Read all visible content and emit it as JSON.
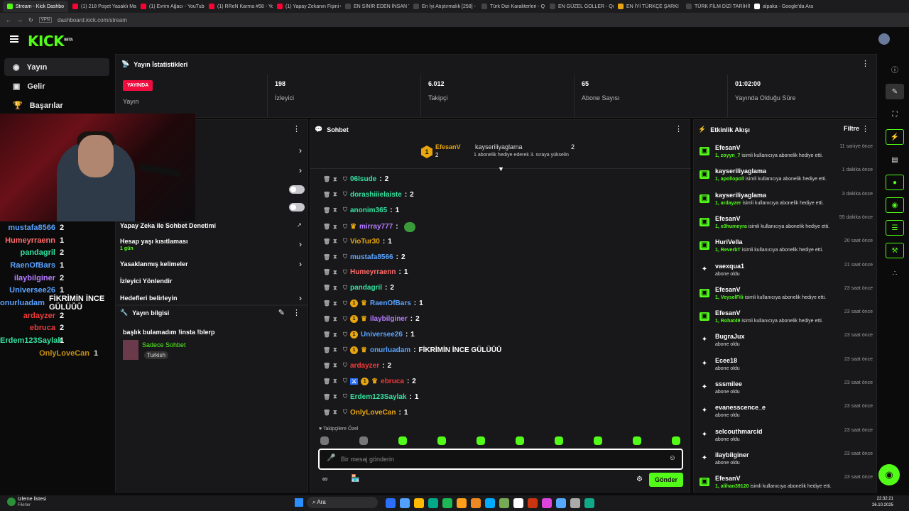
{
  "browser": {
    "tabs": [
      {
        "label": "Stream - Kick Dashbo",
        "color": "#53fc18",
        "active": true
      },
      {
        "label": "(1) 218 Poşet Yasaklı Mas",
        "color": "#ff0033"
      },
      {
        "label": "(1) Evrim Ağacı - YouTube",
        "color": "#ff0033"
      },
      {
        "label": "(1) RReN Karma #58 - Yo",
        "color": "#ff0033"
      },
      {
        "label": "(1) Yapay Zekanın Fişini Ç",
        "color": "#ff0033"
      },
      {
        "label": "EN SİNİR EDEN İNSAN Tİ",
        "color": "#444"
      },
      {
        "label": "En İyi Atıştırmalık [258] -",
        "color": "#444"
      },
      {
        "label": "Türk Dizi Karakterleri - Q",
        "color": "#444"
      },
      {
        "label": "EN GÜZEL GOLLER - Qui",
        "color": "#444"
      },
      {
        "label": "EN İYİ TÜRKÇE ŞARKI",
        "color": "#e8a50f"
      },
      {
        "label": "TÜRK FİLM DİZİ TARİHİN",
        "color": "#444"
      },
      {
        "label": "alpaka - Google'da Ara",
        "color": "#fff"
      }
    ],
    "url": "dashboard.kick.com/stream",
    "vpn": "VPN"
  },
  "logo": {
    "text": "KICK",
    "beta": "BETA"
  },
  "nav": [
    {
      "label": "Yayın",
      "icon": "broadcast-icon",
      "active": true
    },
    {
      "label": "Gelir",
      "icon": "revenue-icon"
    },
    {
      "label": "Başarılar",
      "icon": "trophy-icon"
    }
  ],
  "stats": {
    "title": "Yayın İstatistikleri",
    "live": "YAYINDA",
    "items": [
      {
        "value": "",
        "label": "Yayın"
      },
      {
        "value": "198",
        "label": "İzleyici"
      },
      {
        "value": "6.012",
        "label": "Takipçi"
      },
      {
        "value": "65",
        "label": "Abone Sayısı"
      },
      {
        "value": "01:02:00",
        "label": "Yayında Olduğu Süre"
      }
    ]
  },
  "overlay_list": [
    {
      "name": "mustafa8566",
      "count": "2",
      "color": "#5aa3ff"
    },
    {
      "name": "Humeyrraenn",
      "count": "1",
      "color": "#ff6b6b"
    },
    {
      "name": "pandagril",
      "count": "2",
      "color": "#34e3a0"
    },
    {
      "name": "RaenOfBars",
      "count": "1",
      "color": "#5aa3ff"
    },
    {
      "name": "ilaybilginer",
      "count": "2",
      "color": "#b57cff"
    },
    {
      "name": "Universee26",
      "count": "1",
      "color": "#5aa3ff"
    },
    {
      "name": "onurluadam",
      "count": "FİKRİMİN İNCE GÜLÜŪŪ",
      "color": "#5aa3ff"
    },
    {
      "name": "ardayzer",
      "count": "2",
      "color": "#ef3b3b"
    },
    {
      "name": "ebruca",
      "count": "2",
      "color": "#ef3b3b"
    },
    {
      "name": "Erdem123Saylak",
      "count": "1",
      "color": "#34e3a0"
    },
    {
      "name": "OnlyLoveCan",
      "count": "1",
      "color": "#e8a50f"
    }
  ],
  "settings": {
    "rows": [
      "Yapay Zeka ile Sohbet Denetimi",
      "Hesap yaşı kısıtlaması",
      "Yasaklanmış kelimeler",
      "İzleyici Yönlendir",
      "Hedefleri belirleyin"
    ],
    "age_value": "1 gün",
    "partial": "t"
  },
  "stream_info": {
    "title": "Yayın bilgisi",
    "stream_title": "başlık bulamadım !insta !blerp",
    "category": "Sadece Sohbet",
    "language": "Turkish"
  },
  "chat": {
    "title": "Sohbet",
    "pinned": {
      "gifter": "EfesanV",
      "gifter_count": "2",
      "recipient": "kayseriliyaglama",
      "recipient_count": "2",
      "text": "1 abonelik hediye ederek 3. sıraya yükselin",
      "rank": "1"
    },
    "messages": [
      {
        "user": "06Isude",
        "text": "2",
        "color": "#34e3a0",
        "badges": []
      },
      {
        "user": "dorashiiielaiste",
        "text": "2",
        "color": "#34e3a0",
        "badges": []
      },
      {
        "user": "anonim365",
        "text": "1",
        "color": "#34e3a0",
        "badges": []
      },
      {
        "user": "mirray777",
        "text": "",
        "color": "#b57cff",
        "badges": [
          "crown"
        ],
        "emote": true
      },
      {
        "user": "VioTur30",
        "text": "1",
        "color": "#e8a50f",
        "badges": []
      },
      {
        "user": "mustafa8566",
        "text": "2",
        "color": "#5aa3ff",
        "badges": []
      },
      {
        "user": "Humeyrraenn",
        "text": "1",
        "color": "#ff6b6b",
        "badges": []
      },
      {
        "user": "pandagril",
        "text": "2",
        "color": "#34e3a0",
        "badges": []
      },
      {
        "user": "RaenOfBars",
        "text": "1",
        "color": "#5aa3ff",
        "badges": [
          "1",
          "crown"
        ]
      },
      {
        "user": "ilaybilginer",
        "text": "2",
        "color": "#b57cff",
        "badges": [
          "1",
          "crown"
        ]
      },
      {
        "user": "Universee26",
        "text": "1",
        "color": "#5aa3ff",
        "badges": [
          "1"
        ]
      },
      {
        "user": "onurluadam",
        "text": "FİKRİMİN İNCE GÜLÜŪŪ",
        "color": "#5aa3ff",
        "badges": [
          "1",
          "crown"
        ]
      },
      {
        "user": "ardayzer",
        "text": "2",
        "color": "#ef3b3b",
        "badges": []
      },
      {
        "user": "ebruca",
        "text": "2",
        "color": "#ef3b3b",
        "badges": [
          "mod",
          "1",
          "crown"
        ]
      },
      {
        "user": "Erdem123Saylak",
        "text": "1",
        "color": "#34e3a0",
        "badges": []
      },
      {
        "user": "OnlyLoveCan",
        "text": "1",
        "color": "#e8a50f",
        "badges": []
      }
    ],
    "followers_only": "Takipçilere Özel",
    "placeholder": "Bir mesaj gönderin",
    "send": "Gönder"
  },
  "events": {
    "title": "Etkinlik Akışı",
    "filter": "Filtre",
    "items": [
      {
        "name": "EfesanV",
        "time": "11 saniye önce",
        "type": "gift",
        "count": "1,",
        "who": "zoyyn_7",
        "desc": "isimli kullanıcıya abonelik hediye etti."
      },
      {
        "name": "kayseriliyaglama",
        "time": "1 dakika önce",
        "type": "gift",
        "count": "1,",
        "who": "apollopoll",
        "desc": "isimli kullanıcıya abonelik hediye etti."
      },
      {
        "name": "kayseriliyaglama",
        "time": "3 dakika önce",
        "type": "gift",
        "count": "1,",
        "who": "ardayzer",
        "desc": "isimli kullanıcıya abonelik hediye etti."
      },
      {
        "name": "EfesanV",
        "time": "55 dakika önce",
        "type": "gift",
        "count": "1,",
        "who": "x0humeyra",
        "desc": "isimli kullanıcıya abonelik hediye etti."
      },
      {
        "name": "HuriVella",
        "time": "20 saat önce",
        "type": "gift",
        "count": "1,",
        "who": "ReverbT",
        "desc": "isimli kullanıcıya abonelik hediye etti."
      },
      {
        "name": "vaexqua1",
        "time": "21 saat önce",
        "type": "sub",
        "desc": "abone oldu"
      },
      {
        "name": "EfesanV",
        "time": "23 saat önce",
        "type": "gift",
        "count": "1,",
        "who": "VeyselFili",
        "desc": "isimli kullanıcıya abonelik hediye etti."
      },
      {
        "name": "EfesanV",
        "time": "23 saat önce",
        "type": "gift",
        "count": "1,",
        "who": "Rohat49",
        "desc": "isimli kullanıcıya abonelik hediye etti."
      },
      {
        "name": "BugraJux",
        "time": "23 saat önce",
        "type": "sub",
        "desc": "abone oldu"
      },
      {
        "name": "Ecee18",
        "time": "23 saat önce",
        "type": "sub",
        "desc": "abone oldu"
      },
      {
        "name": "sssmilee",
        "time": "23 saat önce",
        "type": "sub",
        "desc": "abone oldu"
      },
      {
        "name": "evanesscence_e",
        "time": "23 saat önce",
        "type": "sub",
        "desc": "abone oldu"
      },
      {
        "name": "selcouthmarcid",
        "time": "23 saat önce",
        "type": "sub",
        "desc": "abone oldu"
      },
      {
        "name": "ilaybilginer",
        "time": "23 saat önce",
        "type": "sub",
        "desc": "abone oldu"
      },
      {
        "name": "EfesanV",
        "time": "23 saat önce",
        "type": "gift",
        "count": "1,",
        "who": "alihan39120",
        "desc": "isimli kullanıcıya abonelik hediye etti."
      }
    ]
  },
  "taskbar": {
    "watchlist": "İzleme listesi",
    "watchlist_sub": "Fikirler",
    "search": "Ara",
    "clock": "22:32:21",
    "date": "26.10.2025",
    "colors": [
      "#2b6fff",
      "#53a1ff",
      "#ffb900",
      "#0a8",
      "#1db954",
      "#ff9f1a",
      "#e82",
      "#0af",
      "#7a5",
      "#fff",
      "#c31",
      "#d4d",
      "#5af",
      "#aaa",
      "#1a8"
    ]
  },
  "accent": "#53fc18"
}
